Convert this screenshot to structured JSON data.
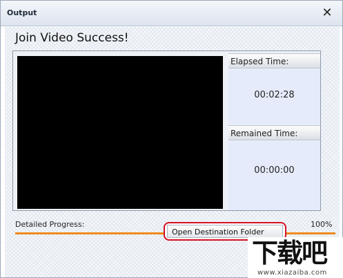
{
  "window": {
    "title": "Output",
    "close_glyph": "✕",
    "close_icon": "close-icon"
  },
  "main": {
    "heading": "Join Video Success!"
  },
  "timers": {
    "elapsed_label": "Elapsed Time:",
    "elapsed_value": "00:02:28",
    "remained_label": "Remained Time:",
    "remained_value": "00:00:00"
  },
  "progress": {
    "label": "Detailed Progress:",
    "value_text": "100%",
    "fraction": 1.0,
    "fill_color": "#f08a1c"
  },
  "actions": {
    "open_destination_label": "Open Destination Folder",
    "highlight_color": "#d40f1f"
  },
  "watermark": {
    "logo_text": "下载吧",
    "url": "www.xiazaiba.com"
  }
}
